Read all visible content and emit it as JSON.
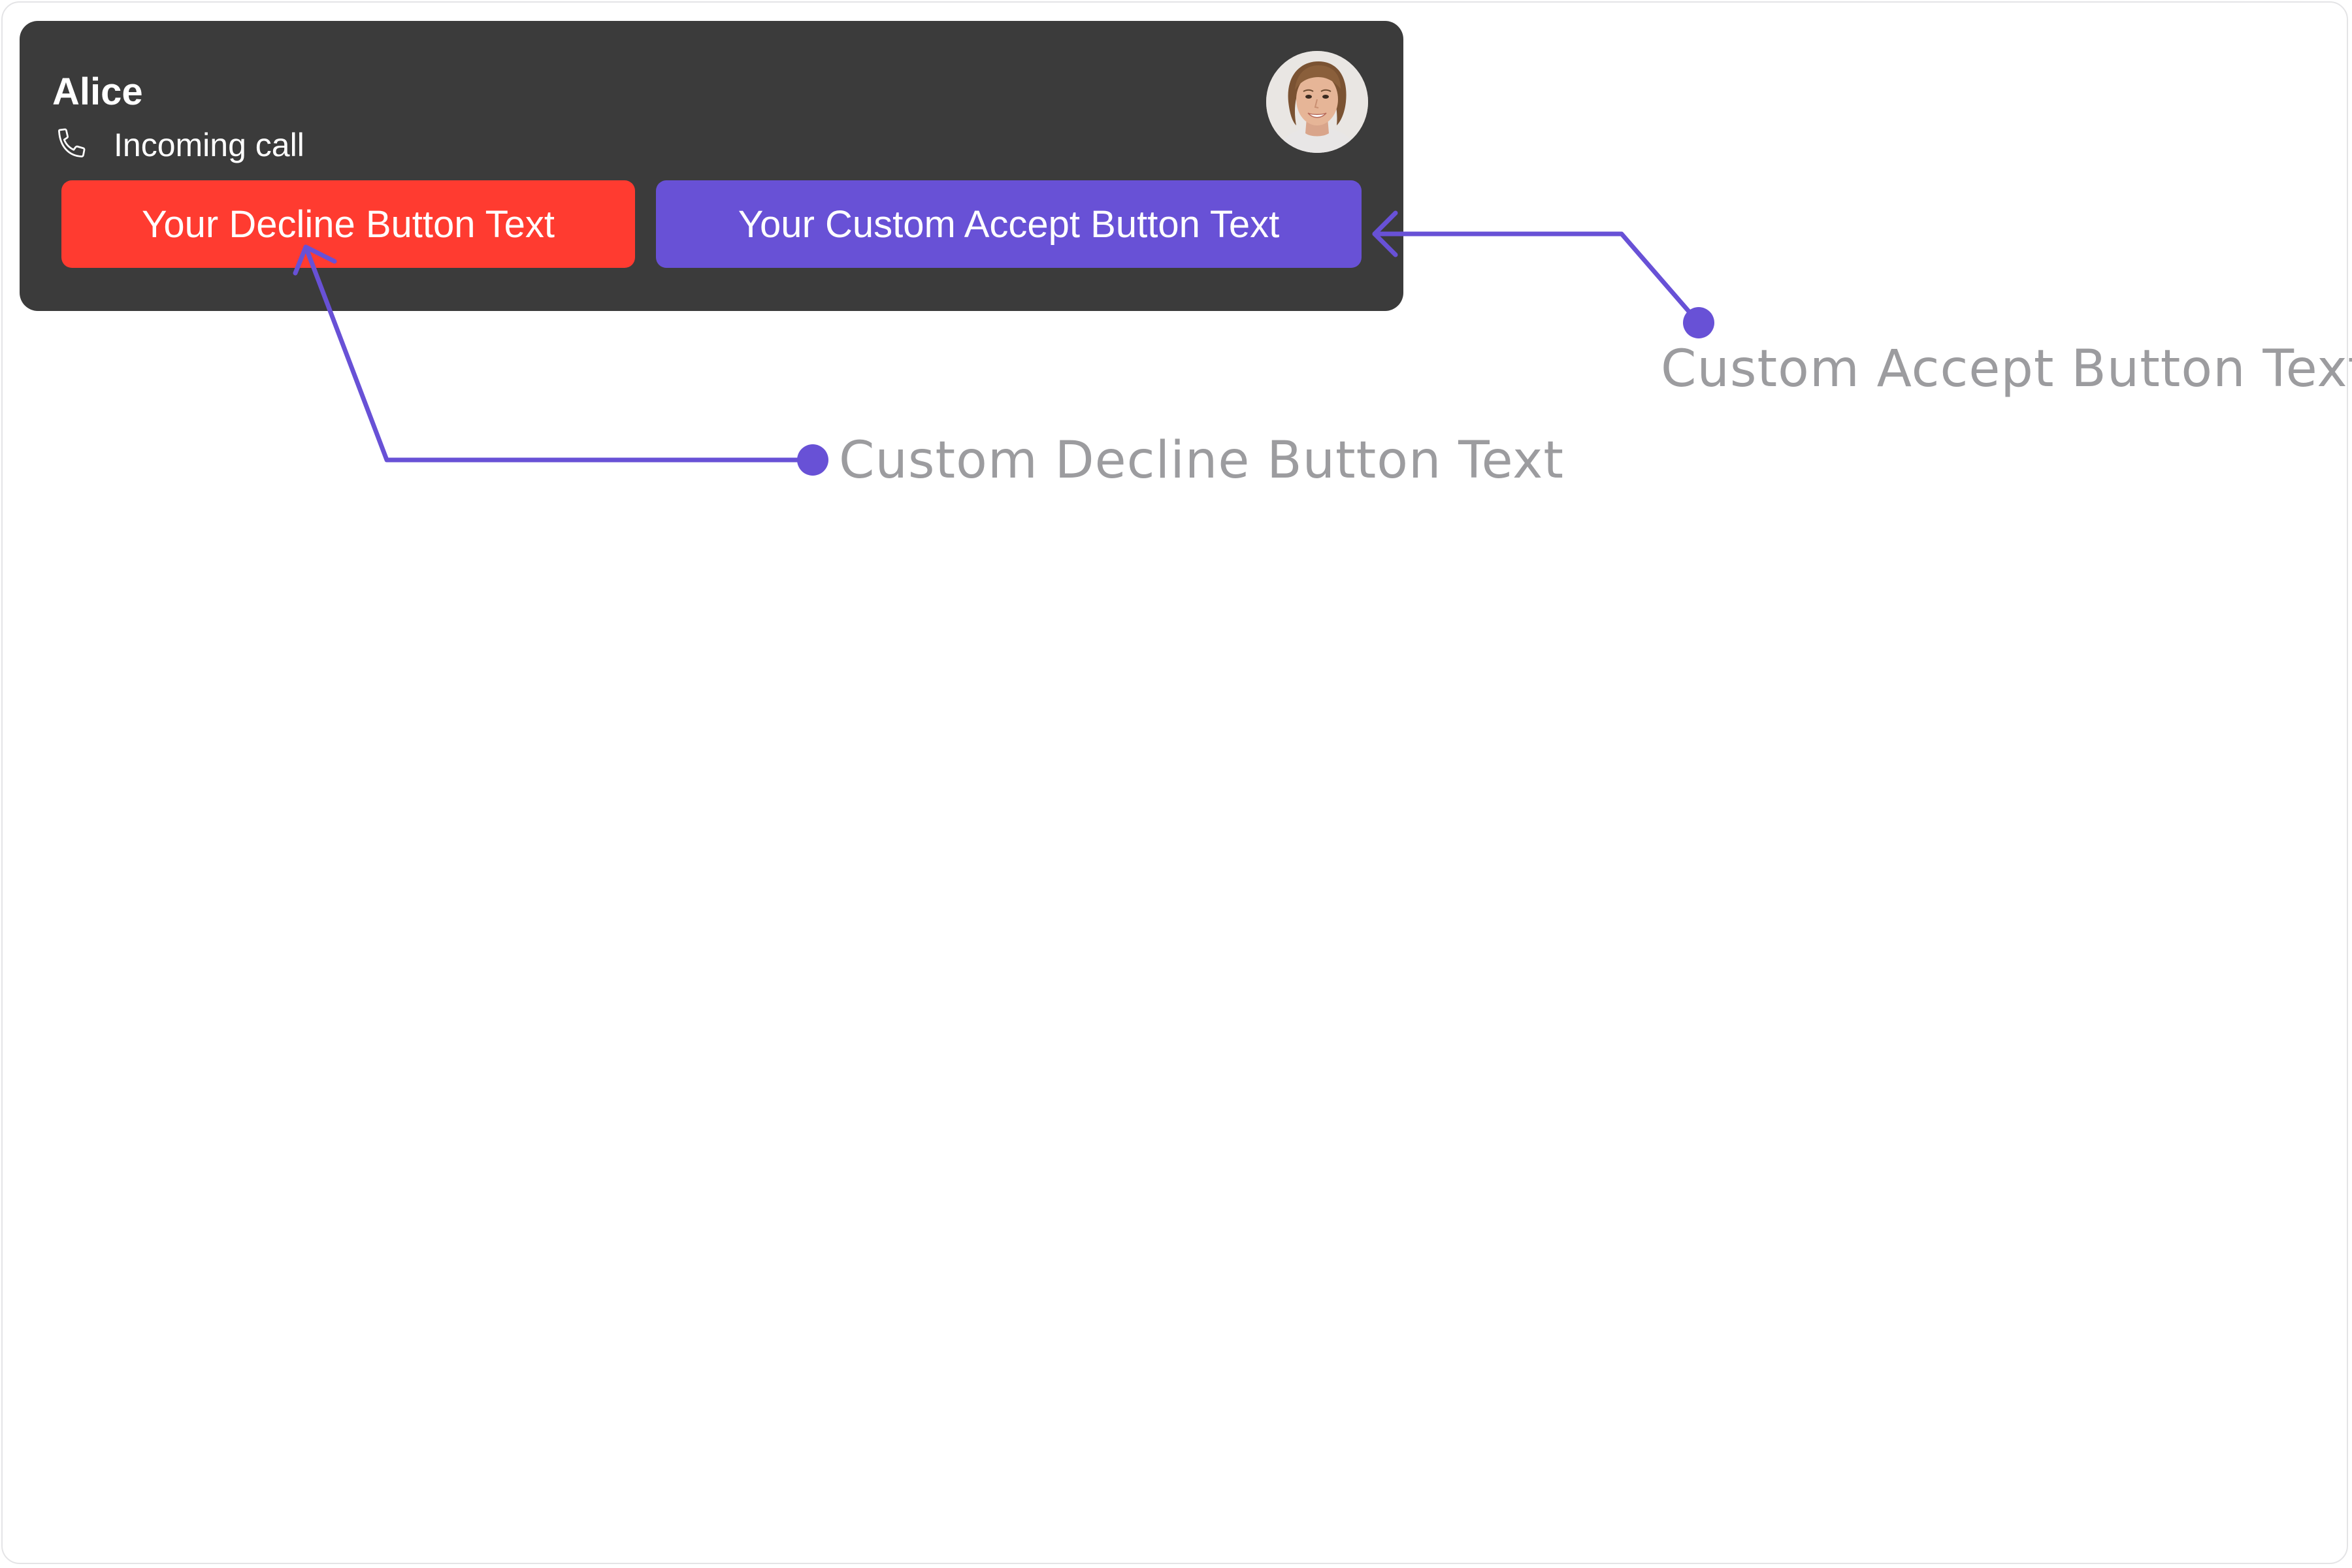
{
  "call": {
    "caller_name": "Alice",
    "status_text": "Incoming call",
    "status_icon": "phone-icon",
    "avatar": "avatar-photo",
    "decline_label": "Your Decline Button Text",
    "accept_label": "Your Custom Accept Button Text"
  },
  "annotations": {
    "accept_label": "Custom Accept Button Text",
    "decline_label": "Custom Decline Button Text"
  },
  "colors": {
    "card_background": "#3b3b3b",
    "decline": "#ff3b30",
    "accept": "#6851d6",
    "annotation_line": "#6851d6",
    "annotation_text": "#9c9c9f"
  }
}
